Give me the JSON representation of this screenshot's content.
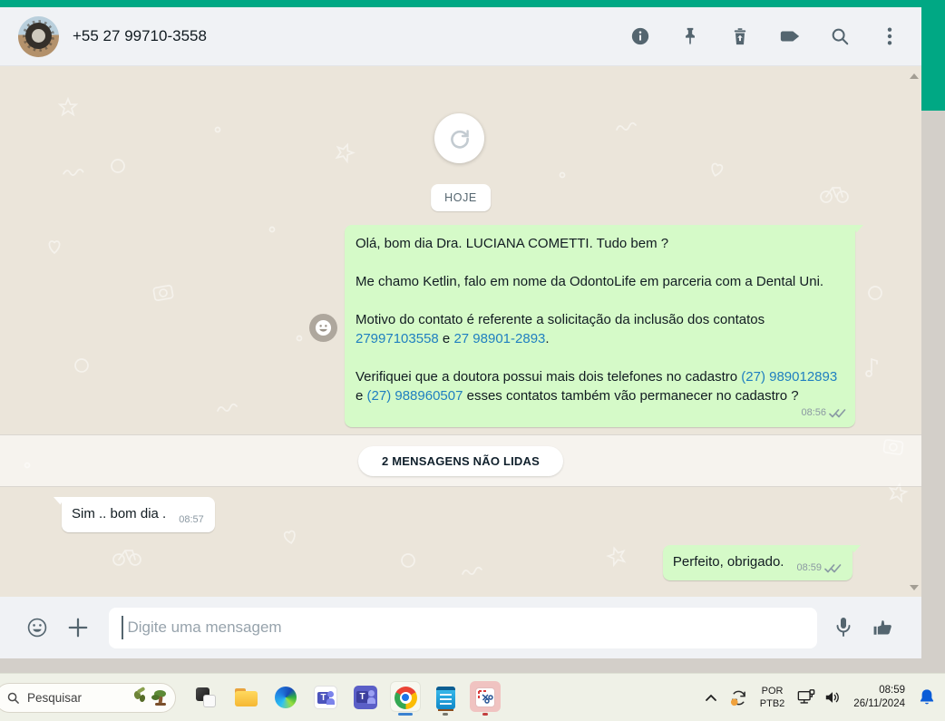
{
  "header": {
    "title": "+55 27 99710-3558",
    "icons": [
      "info-icon",
      "pin-icon",
      "delete-icon",
      "label-icon",
      "search-icon",
      "kebab-menu-icon"
    ]
  },
  "chat": {
    "date_label": "HOJE",
    "unread_label": "2 MENSAGENS NÃO LIDAS",
    "messages": [
      {
        "direction": "out",
        "p1": "Olá, bom dia Dra. LUCIANA COMETTI. Tudo bem ?",
        "p2": "Me chamo Ketlin, falo em nome da OdontoLife em parceria com a Dental Uni.",
        "p3a": "Motivo do contato é referente a solicitação da inclusão dos contatos ",
        "p3_link1": "27997103558",
        "p3b": " e  ",
        "p3_link2": "27 98901-2893",
        "p3c": ".",
        "p4a": "Verifiquei que a doutora possui mais dois telefones no cadastro ",
        "p4_link1": "(27) 989012893",
        "p4b": " e ",
        "p4_link2": "(27) 988960507",
        "p4c": " esses contatos também vão permanecer no cadastro ?",
        "time": "08:56",
        "status": "delivered-double-check"
      },
      {
        "direction": "in",
        "text": "Sim .. bom dia .",
        "time": "08:57"
      },
      {
        "direction": "out",
        "text": "Perfeito, obrigado.",
        "time": "08:59",
        "status": "delivered-double-check"
      }
    ]
  },
  "composer": {
    "placeholder": "Digite uma mensagem",
    "icons": [
      "emoji-icon",
      "plus-icon",
      "microphone-icon",
      "thumbs-up-icon"
    ]
  },
  "taskbar": {
    "search_placeholder": "Pesquisar",
    "apps": [
      "task-view",
      "file-explorer",
      "edge",
      "teams-work",
      "teams-classic",
      "chrome",
      "notepad",
      "snipping-tool"
    ],
    "tray": {
      "language_line1": "POR",
      "language_line2": "PTB2",
      "time": "08:59",
      "date": "26/11/2024",
      "icons": [
        "chevron-up-icon",
        "sync-icon",
        "network-icon",
        "volume-icon",
        "notification-bell-icon"
      ]
    }
  },
  "colors": {
    "accent_green": "#00a884",
    "bubble_out": "#d5fac8",
    "bubble_in": "#ffffff",
    "link_blue": "#1f7fc0",
    "header_icon": "#54656f",
    "chat_background": "#ebe5da",
    "taskbar_background": "#eff1e7",
    "bell_blue": "#0b5cd7"
  }
}
